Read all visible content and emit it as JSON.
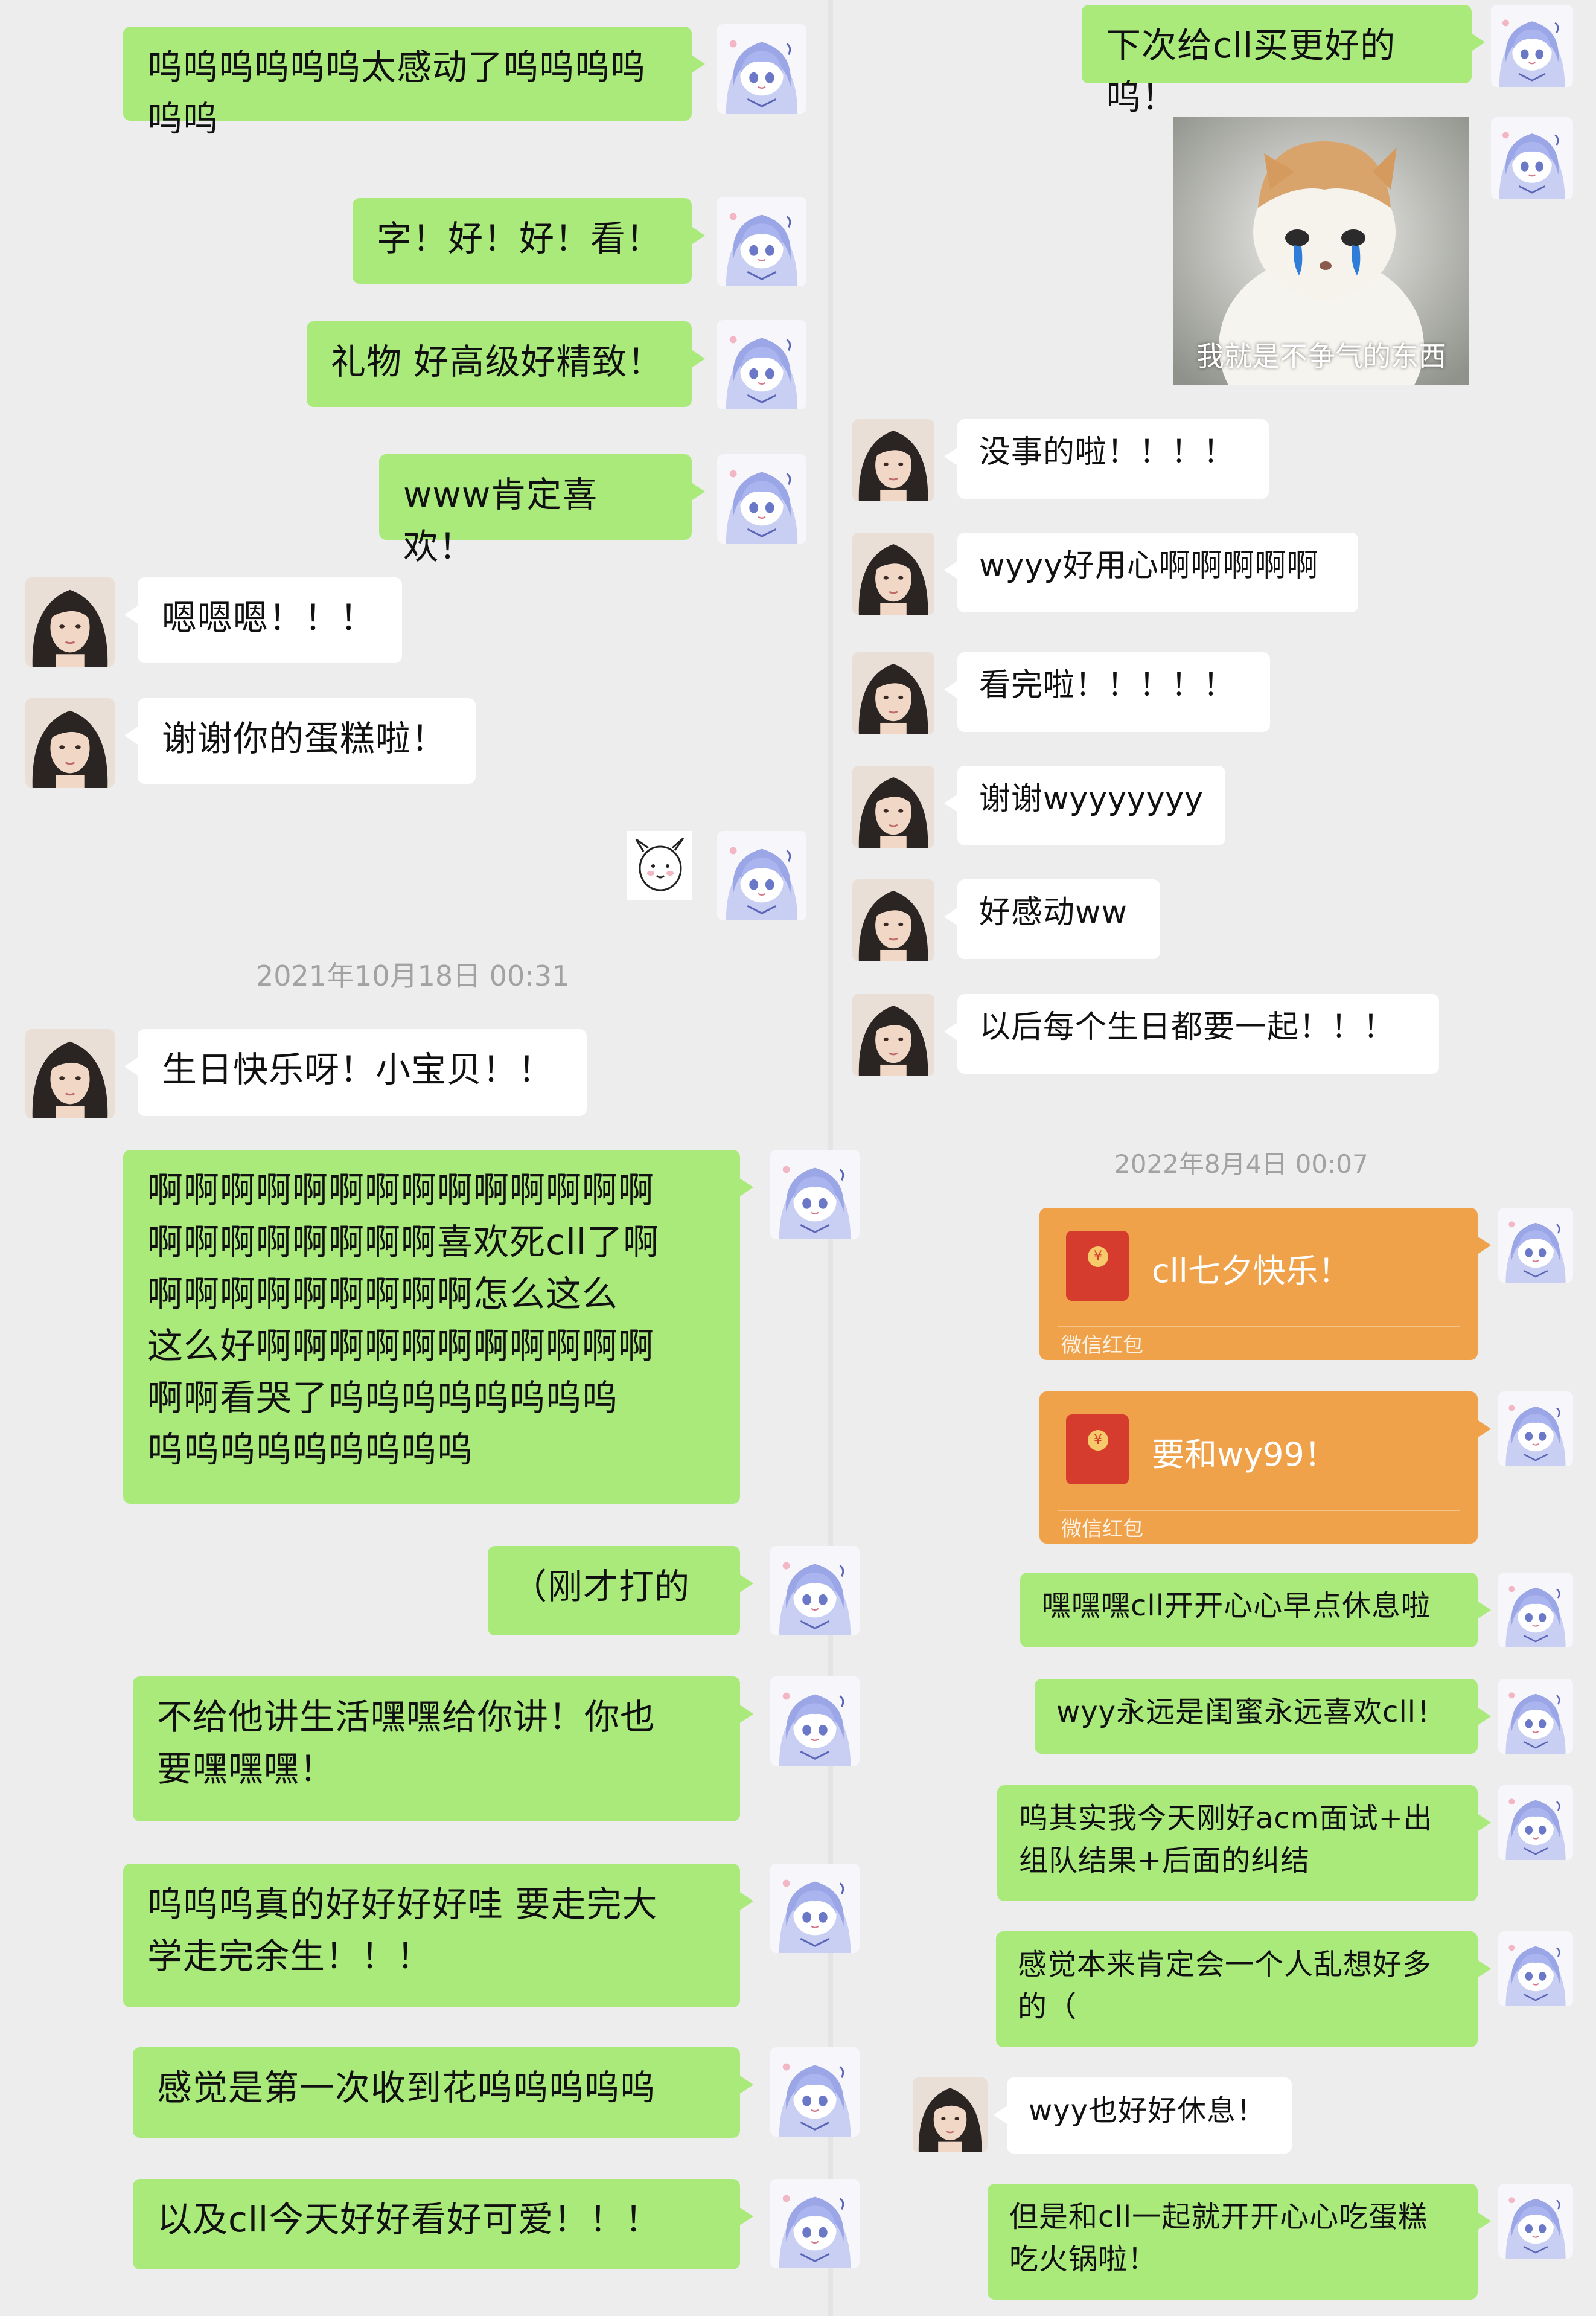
{
  "left_column": {
    "messages": [
      {
        "side": "right",
        "text": "呜呜呜呜呜呜太感动了呜呜呜呜\n呜呜"
      },
      {
        "side": "right",
        "text": "字！好！好！看！"
      },
      {
        "side": "right",
        "text": "礼物 好高级好精致！"
      },
      {
        "side": "right",
        "text": "www肯定喜欢！"
      },
      {
        "side": "left",
        "text": "嗯嗯嗯！！！"
      },
      {
        "side": "left",
        "text": "谢谢你的蛋糕啦！"
      },
      {
        "side": "left",
        "text": "生日快乐呀！小宝贝！！"
      },
      {
        "side": "right",
        "text": "啊啊啊啊啊啊啊啊啊啊啊啊啊啊\n啊啊啊啊啊啊啊啊喜欢死cll了啊\n啊啊啊啊啊啊啊啊啊怎么这么\n这么好啊啊啊啊啊啊啊啊啊啊啊\n啊啊看哭了呜呜呜呜呜呜呜呜\n呜呜呜呜呜呜呜呜呜"
      },
      {
        "side": "right",
        "text": "（刚才打的"
      },
      {
        "side": "right",
        "text": "不给他讲生活嘿嘿给你讲！你也\n要嘿嘿嘿！"
      },
      {
        "side": "right",
        "text": "呜呜呜真的好好好好哇 要走完大\n学走完余生！！！"
      },
      {
        "side": "right",
        "text": "感觉是第一次收到花呜呜呜呜呜"
      },
      {
        "side": "right",
        "text": "以及cll今天好好看好可爱！！！"
      }
    ],
    "timestamp": "2021年10月18日 00:31"
  },
  "right_column": {
    "messages": [
      {
        "side": "right",
        "text": "下次给cll买更好的呜！"
      },
      {
        "side": "left",
        "text": "没事的啦！！！！"
      },
      {
        "side": "left",
        "text": "wyyy好用心啊啊啊啊啊"
      },
      {
        "side": "left",
        "text": "看完啦！！！！！"
      },
      {
        "side": "left",
        "text": "谢谢wyyyyyyy"
      },
      {
        "side": "left",
        "text": "好感动ww"
      },
      {
        "side": "left",
        "text": "以后每个生日都要一起！！！"
      },
      {
        "side": "right",
        "text": "嘿嘿嘿cll开开心心早点休息啦"
      },
      {
        "side": "right",
        "text": "wyy永远是闺蜜永远喜欢cll！"
      },
      {
        "side": "right",
        "text": "呜其实我今天刚好acm面试+出\n组队结果+后面的纠结"
      },
      {
        "side": "right",
        "text": "感觉本来肯定会一个人乱想好多\n的（"
      },
      {
        "side": "left",
        "text": "wyy也好好休息！"
      },
      {
        "side": "right",
        "text": "但是和cll一起就开开心心吃蛋糕\n吃火锅啦！"
      }
    ],
    "sticker_caption": "我就是不争气的东西",
    "timestamp": "2022年8月4日 00:07",
    "red_packets": [
      {
        "title": "cll七夕快乐！",
        "label": "微信红包"
      },
      {
        "title": "要和wy99！",
        "label": "微信红包"
      }
    ]
  },
  "icons": {
    "self_avatar": "anime-avatar-icon",
    "friend_avatar": "photo-avatar-icon",
    "red_packet": "red-envelope-icon",
    "small_sticker": "goat-sticker-icon"
  },
  "colors": {
    "background": "#ededed",
    "green_bubble": "#a9ea7a",
    "white_bubble": "#ffffff",
    "red_packet": "#f0a24a",
    "timestamp": "#a2a2a2"
  }
}
